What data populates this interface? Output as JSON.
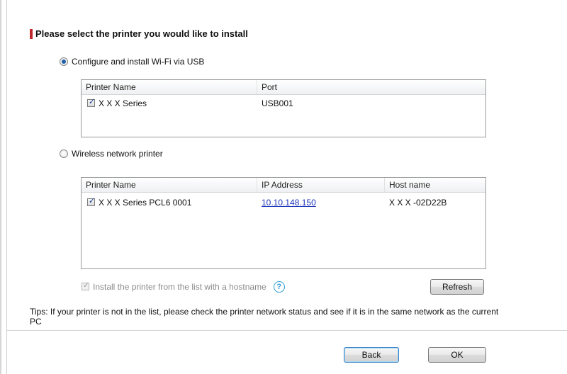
{
  "heading": "Please select the printer you would like to install",
  "usb_option": {
    "label": "Configure and install Wi-Fi via USB",
    "selected": true,
    "columns": [
      "Printer Name",
      "Port"
    ],
    "rows": [
      {
        "checked": true,
        "name": "X X X Series",
        "port": "USB001"
      }
    ]
  },
  "wireless_option": {
    "label": "Wireless network printer",
    "selected": false,
    "columns": [
      "Printer Name",
      "IP Address",
      "Host name"
    ],
    "rows": [
      {
        "checked": true,
        "name": "X X X Series PCL6 0001",
        "ip": "10.10.148.150",
        "host": "X X X -02D22B"
      }
    ]
  },
  "install_hostname": {
    "label": "Install the printer from the list with a hostname",
    "checked": true,
    "disabled": true,
    "help_icon": "?"
  },
  "refresh_button": "Refresh",
  "tips": "Tips: If your printer is not in the list, please check the printer network status and see if it is in the same network as the current PC",
  "back_button": "Back",
  "ok_button": "OK",
  "colors": {
    "accent_bar": "#c0282b",
    "link": "#1a33b8",
    "help_icon": "#2d9bd6",
    "radio_selected": "#1f5fa8"
  }
}
